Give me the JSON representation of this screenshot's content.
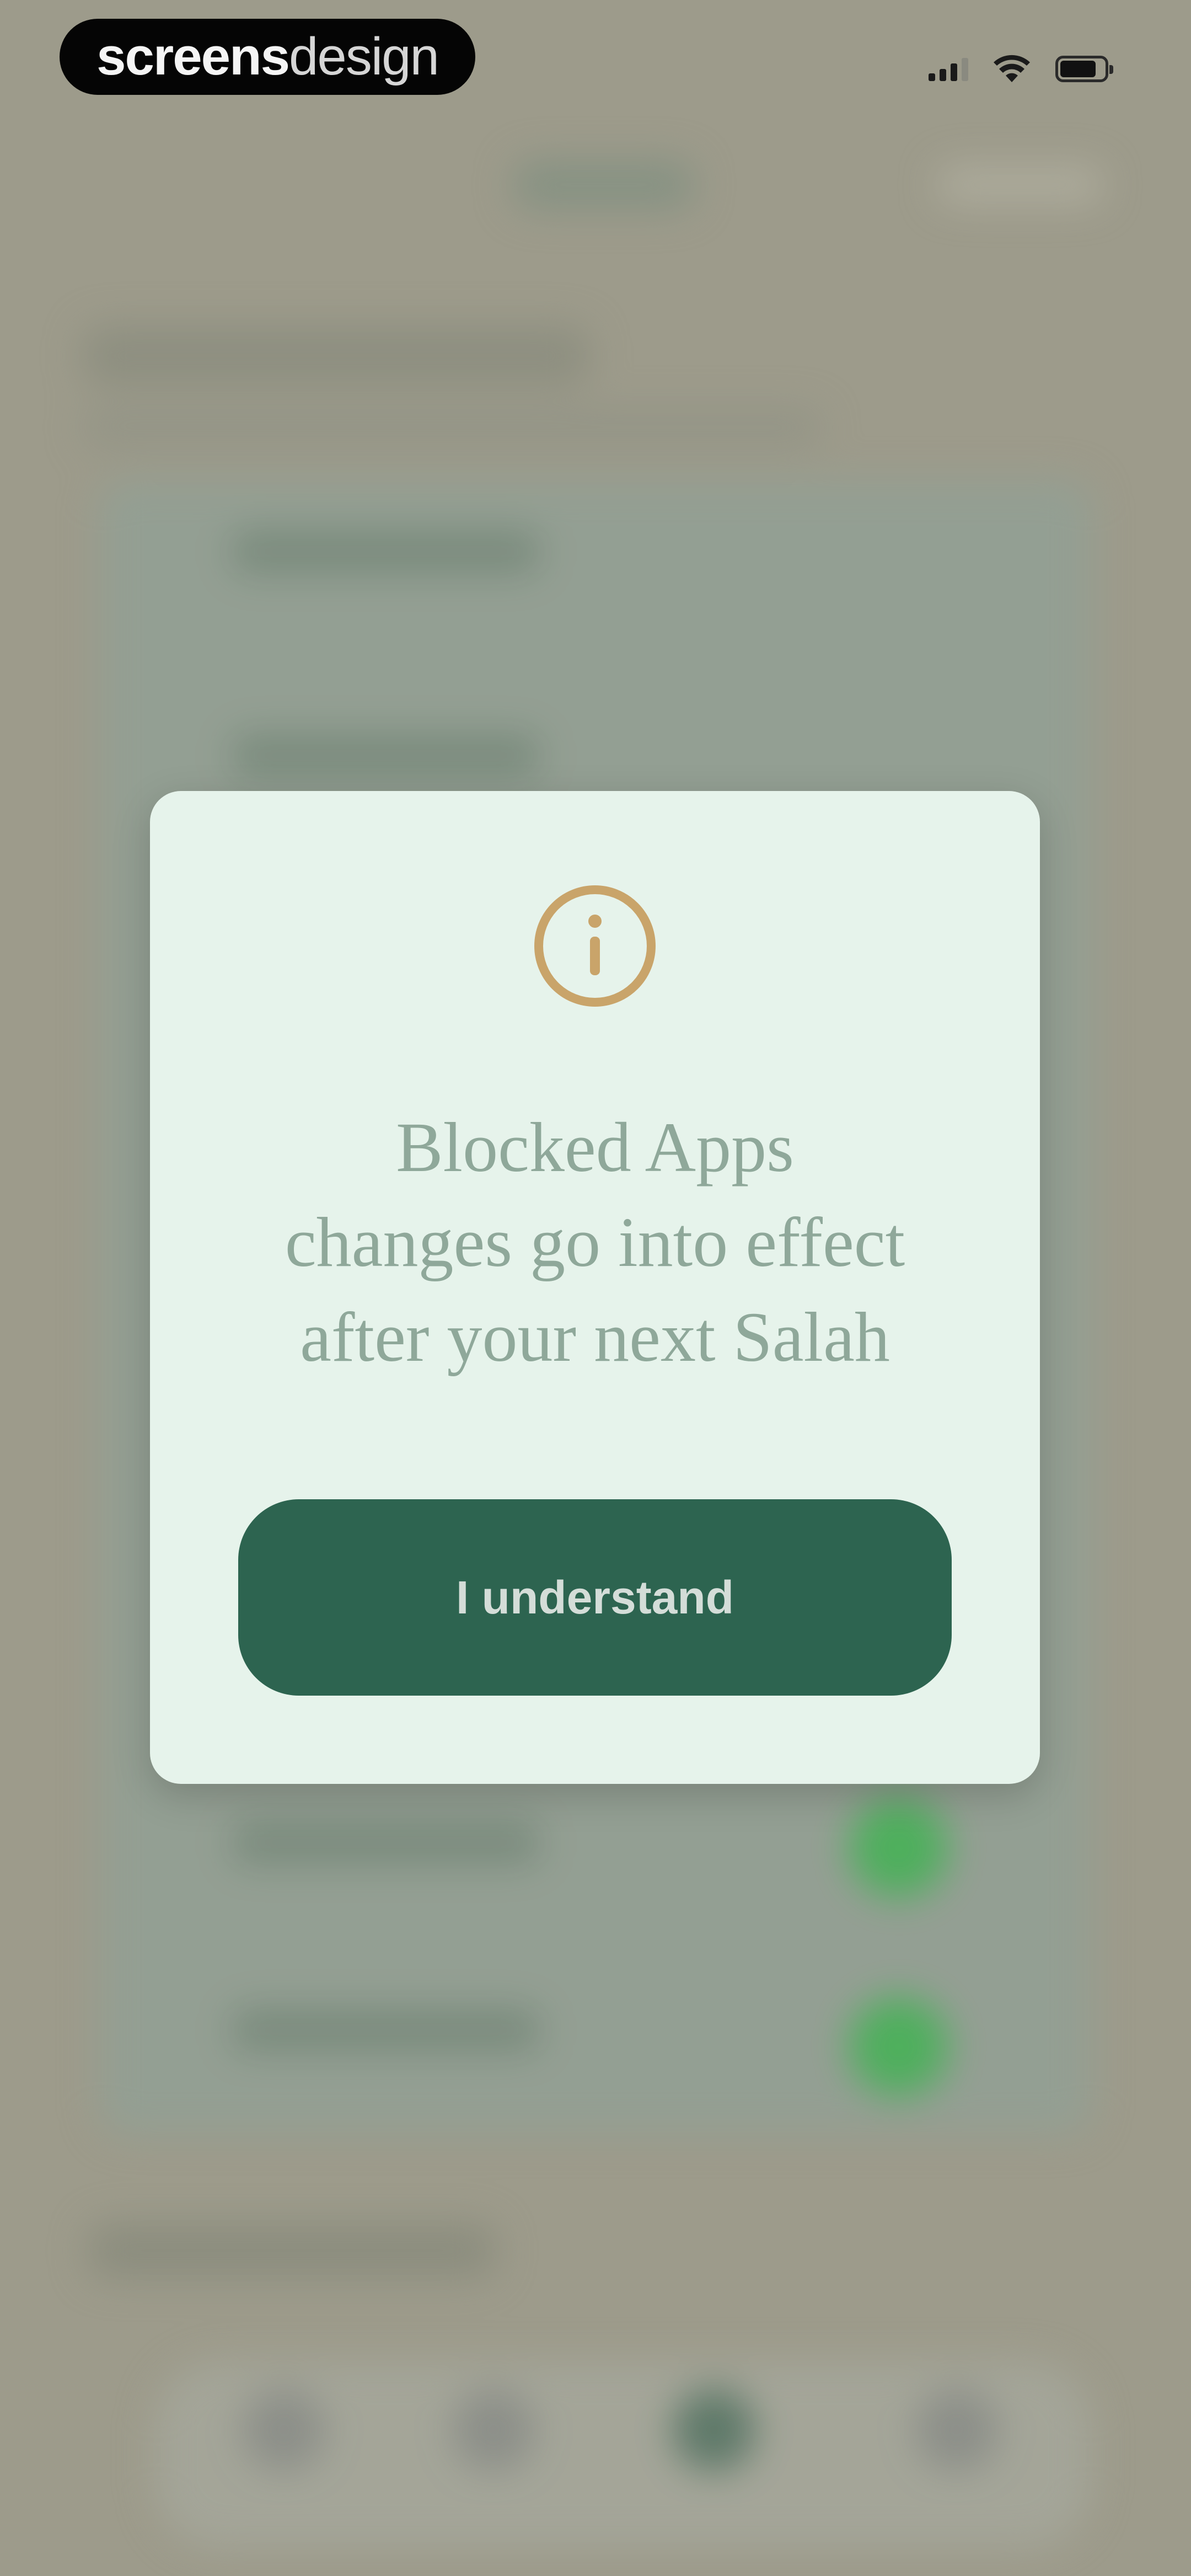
{
  "status_bar": {
    "brand_bold": "screens",
    "brand_light": "design"
  },
  "dialog": {
    "icon": "info-circle-icon",
    "message": "Blocked Apps\nchanges go into effect\nafter your next Salah",
    "button_label": "I understand"
  },
  "colors": {
    "accent": "#2d6450",
    "icon": "#c9a46a",
    "message_text": "#8fa89a",
    "toggle_on": "#4bb05a"
  }
}
